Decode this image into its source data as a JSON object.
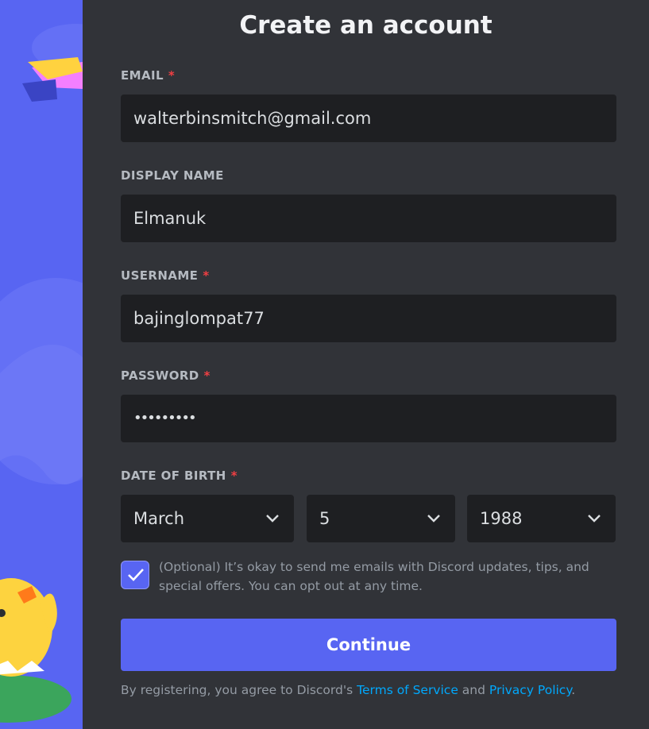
{
  "title": "Create an account",
  "colors": {
    "brand": "#5865f2",
    "required": "#f23f43",
    "link": "#00a8fc",
    "panel": "#313338",
    "input": "#1e1f22"
  },
  "form": {
    "required_marker": "*",
    "email": {
      "label": "EMAIL",
      "value": "walterbinsmitch@gmail.com",
      "required": true
    },
    "display_name": {
      "label": "DISPLAY NAME",
      "value": "Elmanuk",
      "required": false
    },
    "username": {
      "label": "USERNAME",
      "value": "bajinglompat77",
      "required": true
    },
    "password": {
      "label": "PASSWORD",
      "value": "•••••••••",
      "required": true
    },
    "dob": {
      "label": "DATE OF BIRTH",
      "month": "March",
      "day": "5",
      "year": "1988",
      "required": true
    },
    "optin": {
      "checked": true,
      "text": "(Optional) It’s okay to send me emails with Discord updates, tips, and special offers. You can opt out at any time."
    },
    "submit_label": "Continue"
  },
  "legal": {
    "prefix": "By registering, you agree to Discord's ",
    "tos": "Terms of Service",
    "and": " and ",
    "privacy": "Privacy Policy",
    "suffix": "."
  },
  "icons": {
    "dropdown": "chevron-down-icon",
    "check": "checkmark-icon"
  }
}
